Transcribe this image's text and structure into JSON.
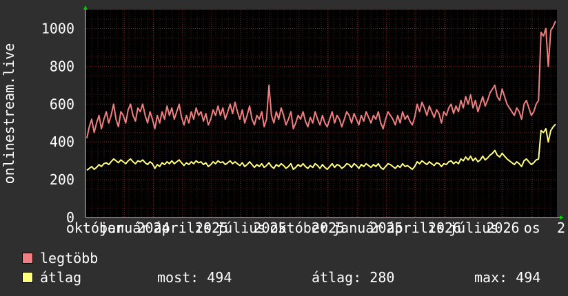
{
  "chart_data": {
    "type": "line",
    "ylabel": "onlinestream.live",
    "ylim": [
      0,
      1100
    ],
    "yticks": [
      0,
      200,
      400,
      600,
      800,
      1000
    ],
    "xtick_labels": [
      "október",
      "január",
      "2024",
      "április",
      "2025",
      "július",
      "2025",
      "október",
      "2025",
      "január",
      "2025",
      "április",
      "2026",
      "július",
      "2026",
      "os",
      "2"
    ],
    "grid": true,
    "legend_position": "bottom-left",
    "colors": {
      "background": "#2f2f2f",
      "plot_bg": "#000000",
      "grid": "#8b2020",
      "axis_arrow": "#00cc00"
    },
    "series": [
      {
        "name": "legtöbb",
        "color": "#f08080",
        "values": [
          420,
          480,
          520,
          450,
          500,
          540,
          470,
          520,
          560,
          500,
          540,
          600,
          520,
          480,
          560,
          540,
          500,
          570,
          600,
          540,
          510,
          580,
          560,
          600,
          540,
          500,
          560,
          520,
          470,
          540,
          500,
          560,
          520,
          590,
          540,
          580,
          520,
          560,
          600,
          530,
          490,
          540,
          500,
          560,
          520,
          580,
          540,
          560,
          510,
          550,
          490,
          520,
          570,
          540,
          590,
          540,
          580,
          520,
          560,
          600,
          550,
          610,
          560,
          520,
          570,
          500,
          540,
          590,
          520,
          490,
          540,
          520,
          560,
          480,
          520,
          700,
          540,
          500,
          560,
          520,
          580,
          540,
          490,
          520,
          560,
          470,
          500,
          540,
          520,
          560,
          510,
          480,
          530,
          500,
          560,
          520,
          490,
          540,
          500,
          480,
          520,
          560,
          500,
          540,
          520,
          480,
          520,
          560,
          540,
          500,
          550,
          520,
          490,
          540,
          510,
          560,
          530,
          500,
          540,
          520,
          560,
          500,
          470,
          520,
          560,
          540,
          520,
          490,
          540,
          500,
          560,
          520,
          540,
          510,
          490,
          530,
          600,
          560,
          610,
          580,
          540,
          590,
          560,
          530,
          570,
          550,
          500,
          560,
          540,
          580,
          600,
          550,
          590,
          560,
          620,
          580,
          640,
          600,
          650,
          580,
          620,
          560,
          600,
          640,
          590,
          620,
          660,
          680,
          700,
          640,
          620,
          680,
          640,
          600,
          580,
          560,
          540,
          580,
          560,
          520,
          600,
          620,
          580,
          540,
          560,
          600,
          620,
          980,
          960,
          1000,
          800,
          990,
          1010,
          1040
        ]
      },
      {
        "name": "átlag",
        "color": "#ffff80",
        "values": [
          250,
          260,
          270,
          255,
          265,
          280,
          270,
          285,
          290,
          280,
          295,
          310,
          300,
          290,
          305,
          295,
          285,
          300,
          310,
          295,
          285,
          300,
          295,
          305,
          290,
          280,
          295,
          285,
          260,
          280,
          270,
          290,
          280,
          295,
          285,
          300,
          285,
          295,
          305,
          290,
          275,
          290,
          280,
          295,
          285,
          300,
          290,
          295,
          280,
          290,
          270,
          280,
          295,
          285,
          300,
          290,
          295,
          280,
          290,
          300,
          285,
          295,
          285,
          275,
          290,
          270,
          280,
          295,
          280,
          265,
          280,
          270,
          285,
          265,
          275,
          290,
          270,
          260,
          280,
          270,
          285,
          275,
          260,
          270,
          285,
          255,
          265,
          280,
          270,
          285,
          270,
          260,
          275,
          265,
          285,
          275,
          260,
          280,
          265,
          255,
          270,
          285,
          265,
          280,
          275,
          260,
          270,
          285,
          280,
          265,
          285,
          275,
          260,
          280,
          270,
          285,
          275,
          265,
          280,
          270,
          285,
          265,
          255,
          270,
          285,
          280,
          270,
          260,
          275,
          265,
          285,
          270,
          275,
          265,
          255,
          270,
          295,
          285,
          300,
          290,
          280,
          295,
          285,
          275,
          290,
          285,
          270,
          285,
          280,
          295,
          300,
          285,
          295,
          285,
          310,
          300,
          320,
          305,
          325,
          300,
          315,
          295,
          305,
          325,
          305,
          315,
          330,
          340,
          355,
          330,
          320,
          340,
          325,
          310,
          300,
          290,
          280,
          295,
          285,
          270,
          300,
          310,
          295,
          280,
          290,
          305,
          310,
          460,
          450,
          470,
          400,
          460,
          480,
          494
        ]
      }
    ],
    "stats": {
      "most_label": "most:",
      "most_value": "494",
      "avg_label": "átlag:",
      "avg_value": "280",
      "max_label": "max:",
      "max_value": "494"
    }
  }
}
